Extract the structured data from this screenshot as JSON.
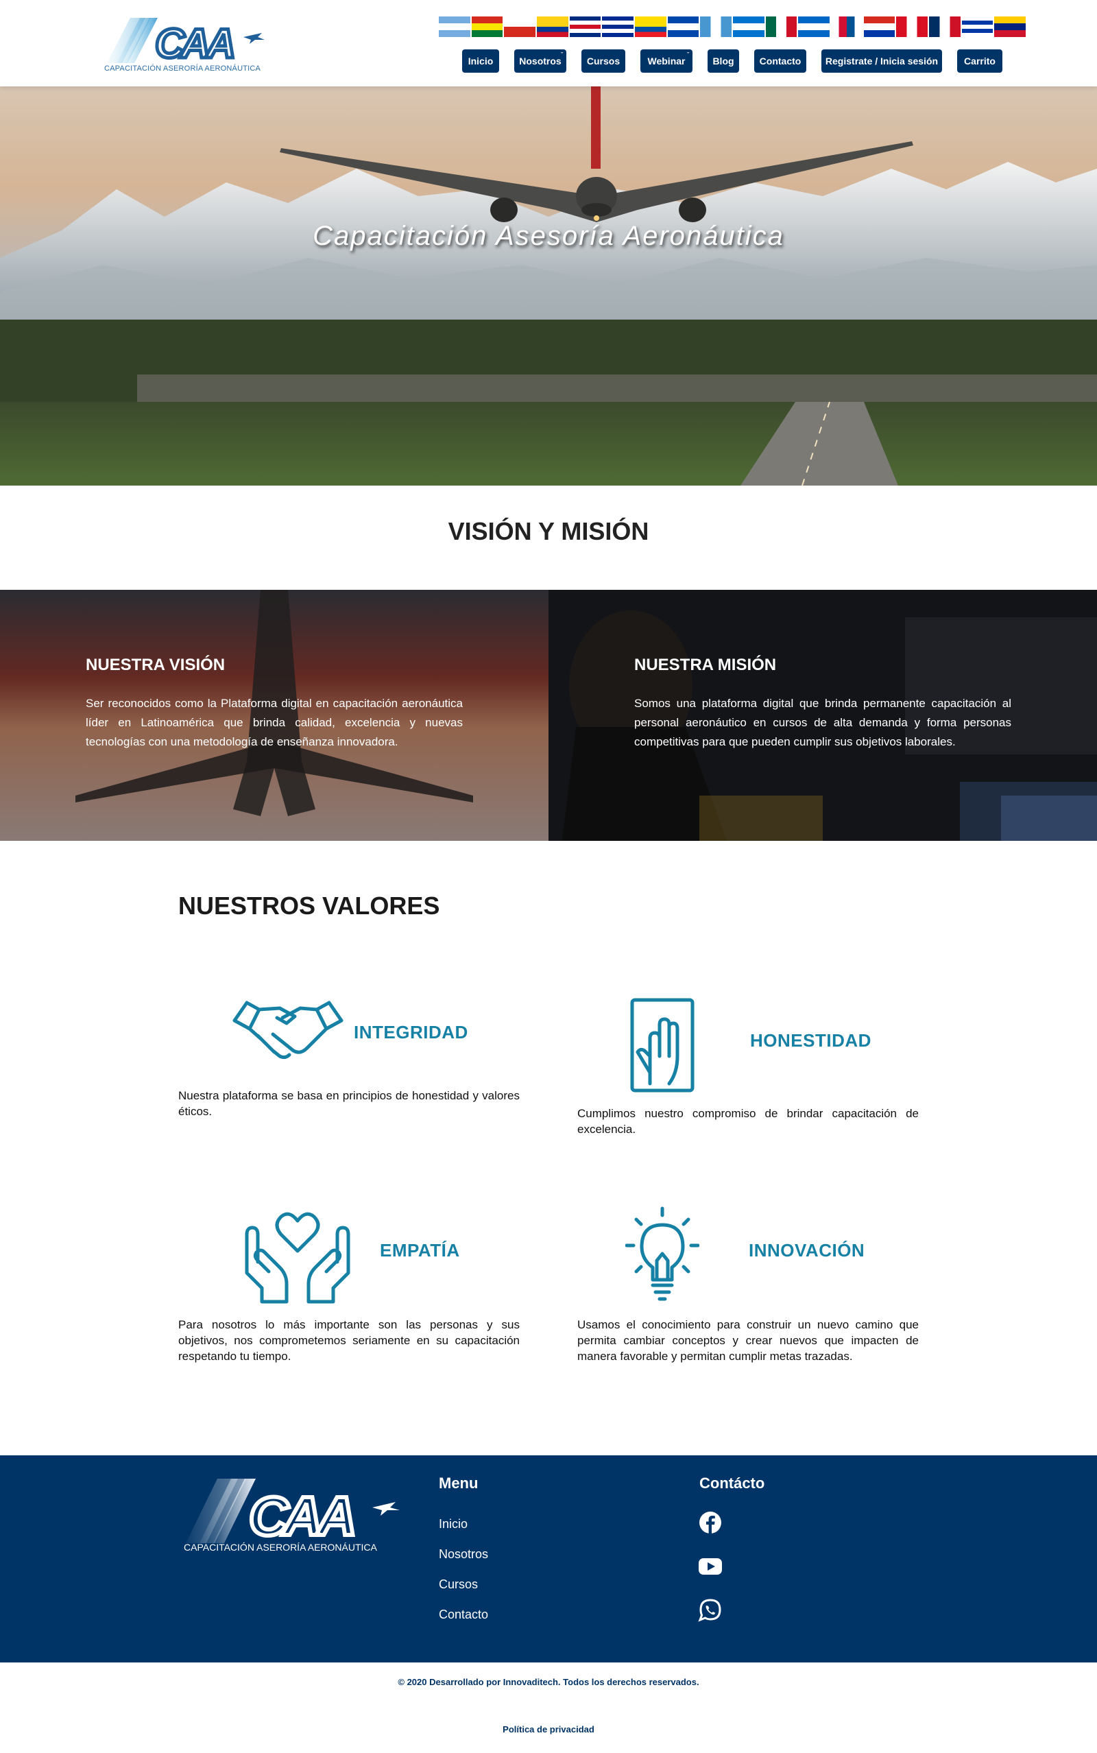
{
  "brand": {
    "logo_text": "CAA",
    "logo_subtitle": "CAPACITACIÓN ASERORÍA AERONÁUTICA",
    "accent_color": "#1681a5",
    "navy_color": "#003366"
  },
  "flags": [
    {
      "country": "argentina"
    },
    {
      "country": "bolivia"
    },
    {
      "country": "chile"
    },
    {
      "country": "colombia"
    },
    {
      "country": "costa-rica"
    },
    {
      "country": "cuba"
    },
    {
      "country": "ecuador"
    },
    {
      "country": "el-salvador"
    },
    {
      "country": "guatemala"
    },
    {
      "country": "honduras"
    },
    {
      "country": "mexico"
    },
    {
      "country": "nicaragua"
    },
    {
      "country": "panama"
    },
    {
      "country": "paraguay"
    },
    {
      "country": "peru"
    },
    {
      "country": "dominican-republic"
    },
    {
      "country": "uruguay"
    },
    {
      "country": "venezuela"
    }
  ],
  "nav": {
    "items": [
      {
        "label": "Inicio",
        "dropdown": false
      },
      {
        "label": "Nosotros",
        "dropdown": true
      },
      {
        "label": "Cursos",
        "dropdown": false
      },
      {
        "label": "Webinar",
        "dropdown": true
      },
      {
        "label": "Blog",
        "dropdown": false
      },
      {
        "label": "Contacto",
        "dropdown": false
      },
      {
        "label": "Registrate / Inicia sesión",
        "dropdown": false
      },
      {
        "label": "Carrito",
        "dropdown": false
      }
    ]
  },
  "hero": {
    "title": "Capacitación Asesoría Aeronáutica"
  },
  "vision_mision": {
    "heading": "VISIÓN Y MISIÓN",
    "vision": {
      "title": "NUESTRA VISIÓN",
      "text": "Ser reconocidos como la Plataforma digital en capacitación aeronáutica líder en Latinoamérica que brinda calidad, excelencia y nuevas tecnologías con una metodología de enseñanza innovadora."
    },
    "mision": {
      "title": "NUESTRA MISIÓN",
      "text": "Somos una plataforma digital que brinda permanente capacitación al personal aeronáutico en cursos de alta demanda y forma personas competitivas para que pueden cumplir sus objetivos laborales."
    }
  },
  "valores": {
    "heading": "NUESTROS VALORES",
    "items": [
      {
        "name": "INTEGRIDAD",
        "icon": "handshake-icon",
        "text": "Nuestra plataforma se basa en principios de honestidad y valores éticos."
      },
      {
        "name": "HONESTIDAD",
        "icon": "hand-on-book-icon",
        "text": "Cumplimos nuestro compromiso de brindar capacitación de excelencia."
      },
      {
        "name": "EMPATÍA",
        "icon": "hands-heart-icon",
        "text": "Para nosotros lo más importante son las personas y sus objetivos, nos comprometemos seriamente en su capacitación respetando tu tiempo."
      },
      {
        "name": "INNOVACIÓN",
        "icon": "lightbulb-icon",
        "text": "Usamos el conocimiento para construir un nuevo camino que permita cambiar conceptos y crear nuevos que impacten de manera favorable y permitan cumplir metas trazadas."
      }
    ]
  },
  "footer": {
    "logo_text": "CAA",
    "logo_subtitle": "CAPACITACIÓN ASERORÍA AERONÁUTICA",
    "menu_heading": "Menu",
    "menu_items": [
      "Inicio",
      "Nosotros",
      "Cursos",
      "Contacto"
    ],
    "contact_heading": "Contácto",
    "social": [
      {
        "icon": "facebook-icon"
      },
      {
        "icon": "youtube-icon"
      },
      {
        "icon": "whatsapp-icon"
      }
    ],
    "copyright": "© 2020 Desarrollado por Innovaditech. Todos los derechos reservados.",
    "privacy": "Política de privacidad"
  }
}
